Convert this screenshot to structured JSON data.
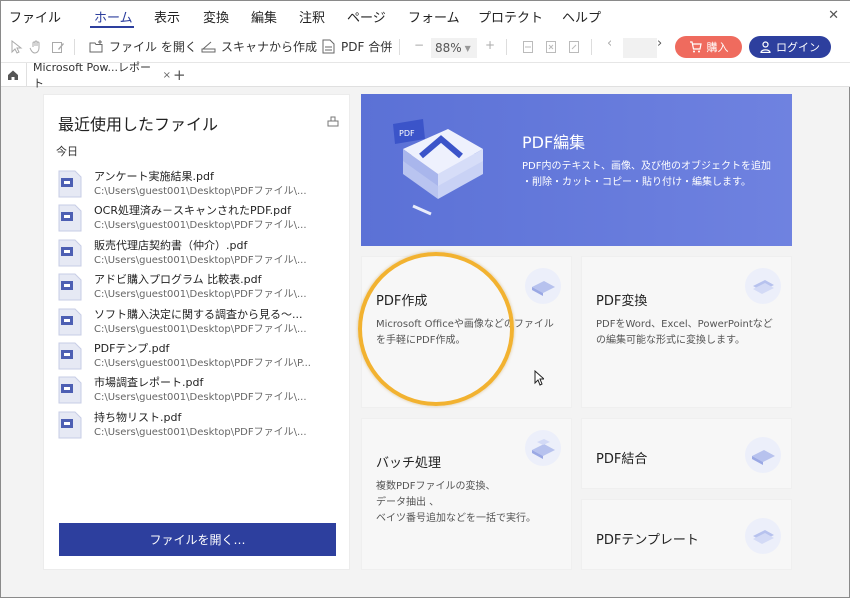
{
  "menubar": {
    "items": [
      "ファイル",
      "ホーム",
      "表示",
      "変換",
      "編集",
      "注釈",
      "ページ",
      "フォーム",
      "プロテクト",
      "ヘルプ"
    ],
    "active_index": 1,
    "close_glyph": "✕"
  },
  "toolbar": {
    "open_file": "ファイル を開く",
    "scan": "スキャナから作成",
    "combine": "PDF 合併",
    "zoom_minus": "−",
    "zoom_value": "88%",
    "zoom_plus": "+",
    "prev": "‹",
    "next": "›",
    "buy": "購入",
    "login": "ログイン"
  },
  "tabs": {
    "items": [
      {
        "label": "Microsoft Pow...レポート",
        "close": "×"
      }
    ],
    "add": "+"
  },
  "recent": {
    "title": "最近使用したファイル",
    "group_label": "今日",
    "files": [
      {
        "name": "アンケート実施結果.pdf",
        "path": "C:\\Users\\guest001\\Desktop\\PDFファイル\\..."
      },
      {
        "name": "OCR処理済み－スキャンされたPDF.pdf",
        "path": "C:\\Users\\guest001\\Desktop\\PDFファイル\\..."
      },
      {
        "name": "販売代理店契約書（仲介）.pdf",
        "path": "C:\\Users\\guest001\\Desktop\\PDFファイル\\..."
      },
      {
        "name": "アドビ購入プログラム 比較表.pdf",
        "path": "C:\\Users\\guest001\\Desktop\\PDFファイル\\..."
      },
      {
        "name": "ソフト購入決定に関する調査から見る～...",
        "path": "C:\\Users\\guest001\\Desktop\\PDFファイル\\..."
      },
      {
        "name": "PDFテンプ.pdf",
        "path": "C:\\Users\\guest001\\Desktop\\PDFファイル\\P..."
      },
      {
        "name": "市場調査レポート.pdf",
        "path": "C:\\Users\\guest001\\Desktop\\PDFファイル\\..."
      },
      {
        "name": "持ち物リスト.pdf",
        "path": "C:\\Users\\guest001\\Desktop\\PDFファイル\\..."
      }
    ],
    "open_button": "ファイルを開く…"
  },
  "hero": {
    "title": "PDF編集",
    "desc_line1": "PDF内のテキスト、画像、及び他のオブジェクトを追加",
    "desc_line2": "・削除・カット・コピー・貼り付け・編集します。",
    "illus_label": "PDF"
  },
  "cards": {
    "create": {
      "title": "PDF作成",
      "desc_line1": "Microsoft Officeや画像などのファイル",
      "desc_line2": "を手軽にPDF作成。"
    },
    "convert": {
      "title": "PDF変換",
      "desc_line1": "PDFをWord、Excel、PowerPointなど",
      "desc_line2": "の編集可能な形式に変換します。"
    },
    "batch": {
      "title": "バッチ処理",
      "desc_line1": "複数PDFファイルの変換、",
      "desc_line2": "データ抽出 、",
      "desc_line3": "ベイツ番号追加などを一括で実行。"
    },
    "combine": {
      "title": "PDF結合"
    },
    "template": {
      "title": "PDFテンプレート"
    }
  },
  "colors": {
    "accent": "#2d3f9e",
    "buy": "#ef6b5e",
    "hero": "#5b71d6",
    "highlight": "#f2b230"
  }
}
